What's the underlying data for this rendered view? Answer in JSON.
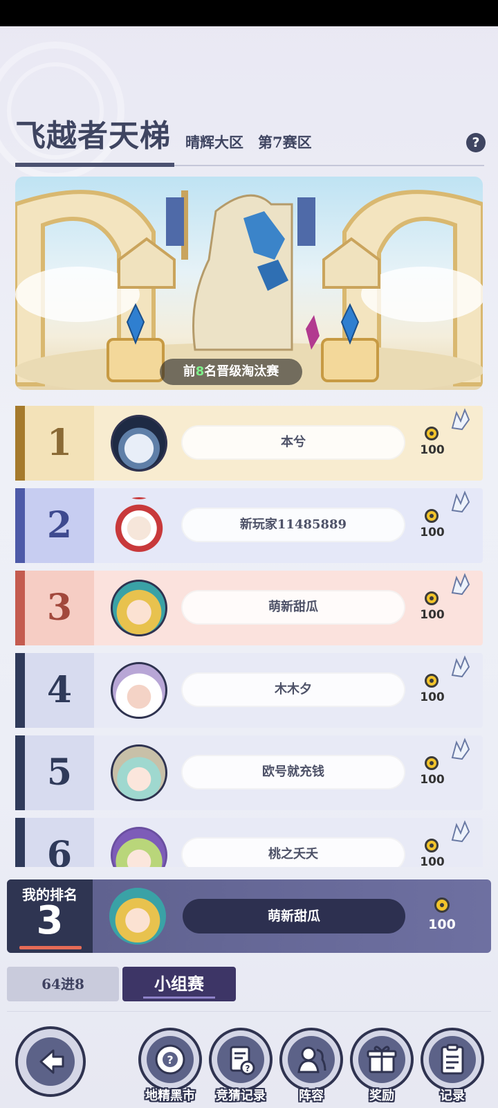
{
  "header": {
    "title": "飞越者天梯",
    "subtitle": "晴辉大区　第7赛区",
    "help_icon": "question-icon"
  },
  "banner": {
    "caption_prefix": "前",
    "caption_highlight": "8",
    "caption_suffix": "名晋级淘汰赛"
  },
  "rankings": [
    {
      "rank": "1",
      "name": "本兮",
      "score": "100",
      "stripe": "#a57a2c",
      "num_bg": "#f3e2b8",
      "num_color": "#8a6a35",
      "row_bg": "#f8ecd0"
    },
    {
      "rank": "2",
      "name": "新玩家11485889",
      "score": "100",
      "stripe": "#4d5aa8",
      "num_bg": "#c7cdf1",
      "num_color": "#3e4a8f",
      "row_bg": "#e5e8f8"
    },
    {
      "rank": "3",
      "name": "萌新甜瓜",
      "score": "100",
      "stripe": "#c45b4f",
      "num_bg": "#f6cdc4",
      "num_color": "#a2483c",
      "row_bg": "#fbe2dd"
    },
    {
      "rank": "4",
      "name": "木木夕",
      "score": "100",
      "stripe": "#2f3a5a",
      "num_bg": "#d7dbef",
      "num_color": "#2f3a5a",
      "row_bg": "#e8eaf6"
    },
    {
      "rank": "5",
      "name": "欧号就充钱",
      "score": "100",
      "stripe": "#2f3a5a",
      "num_bg": "#d7dbef",
      "num_color": "#2f3a5a",
      "row_bg": "#e8eaf6"
    },
    {
      "rank": "6",
      "name": "桃之夭夭",
      "score": "100",
      "stripe": "#2f3a5a",
      "num_bg": "#d7dbef",
      "num_color": "#2f3a5a",
      "row_bg": "#e8eaf6"
    }
  ],
  "my_rank": {
    "label": "我的排名",
    "rank": "3",
    "name": "萌新甜瓜",
    "score": "100"
  },
  "tabs": [
    {
      "label": "64进8",
      "active": false
    },
    {
      "label": "小组赛",
      "active": true
    }
  ],
  "nav": {
    "back_icon": "back-arrow-icon",
    "items": [
      {
        "label": "地精黑市",
        "icon": "market-icon"
      },
      {
        "label": "竞猜记录",
        "icon": "bet-record-icon"
      },
      {
        "label": "阵容",
        "icon": "lineup-icon"
      },
      {
        "label": "奖励",
        "icon": "gift-icon"
      },
      {
        "label": "记录",
        "icon": "record-icon"
      }
    ]
  }
}
